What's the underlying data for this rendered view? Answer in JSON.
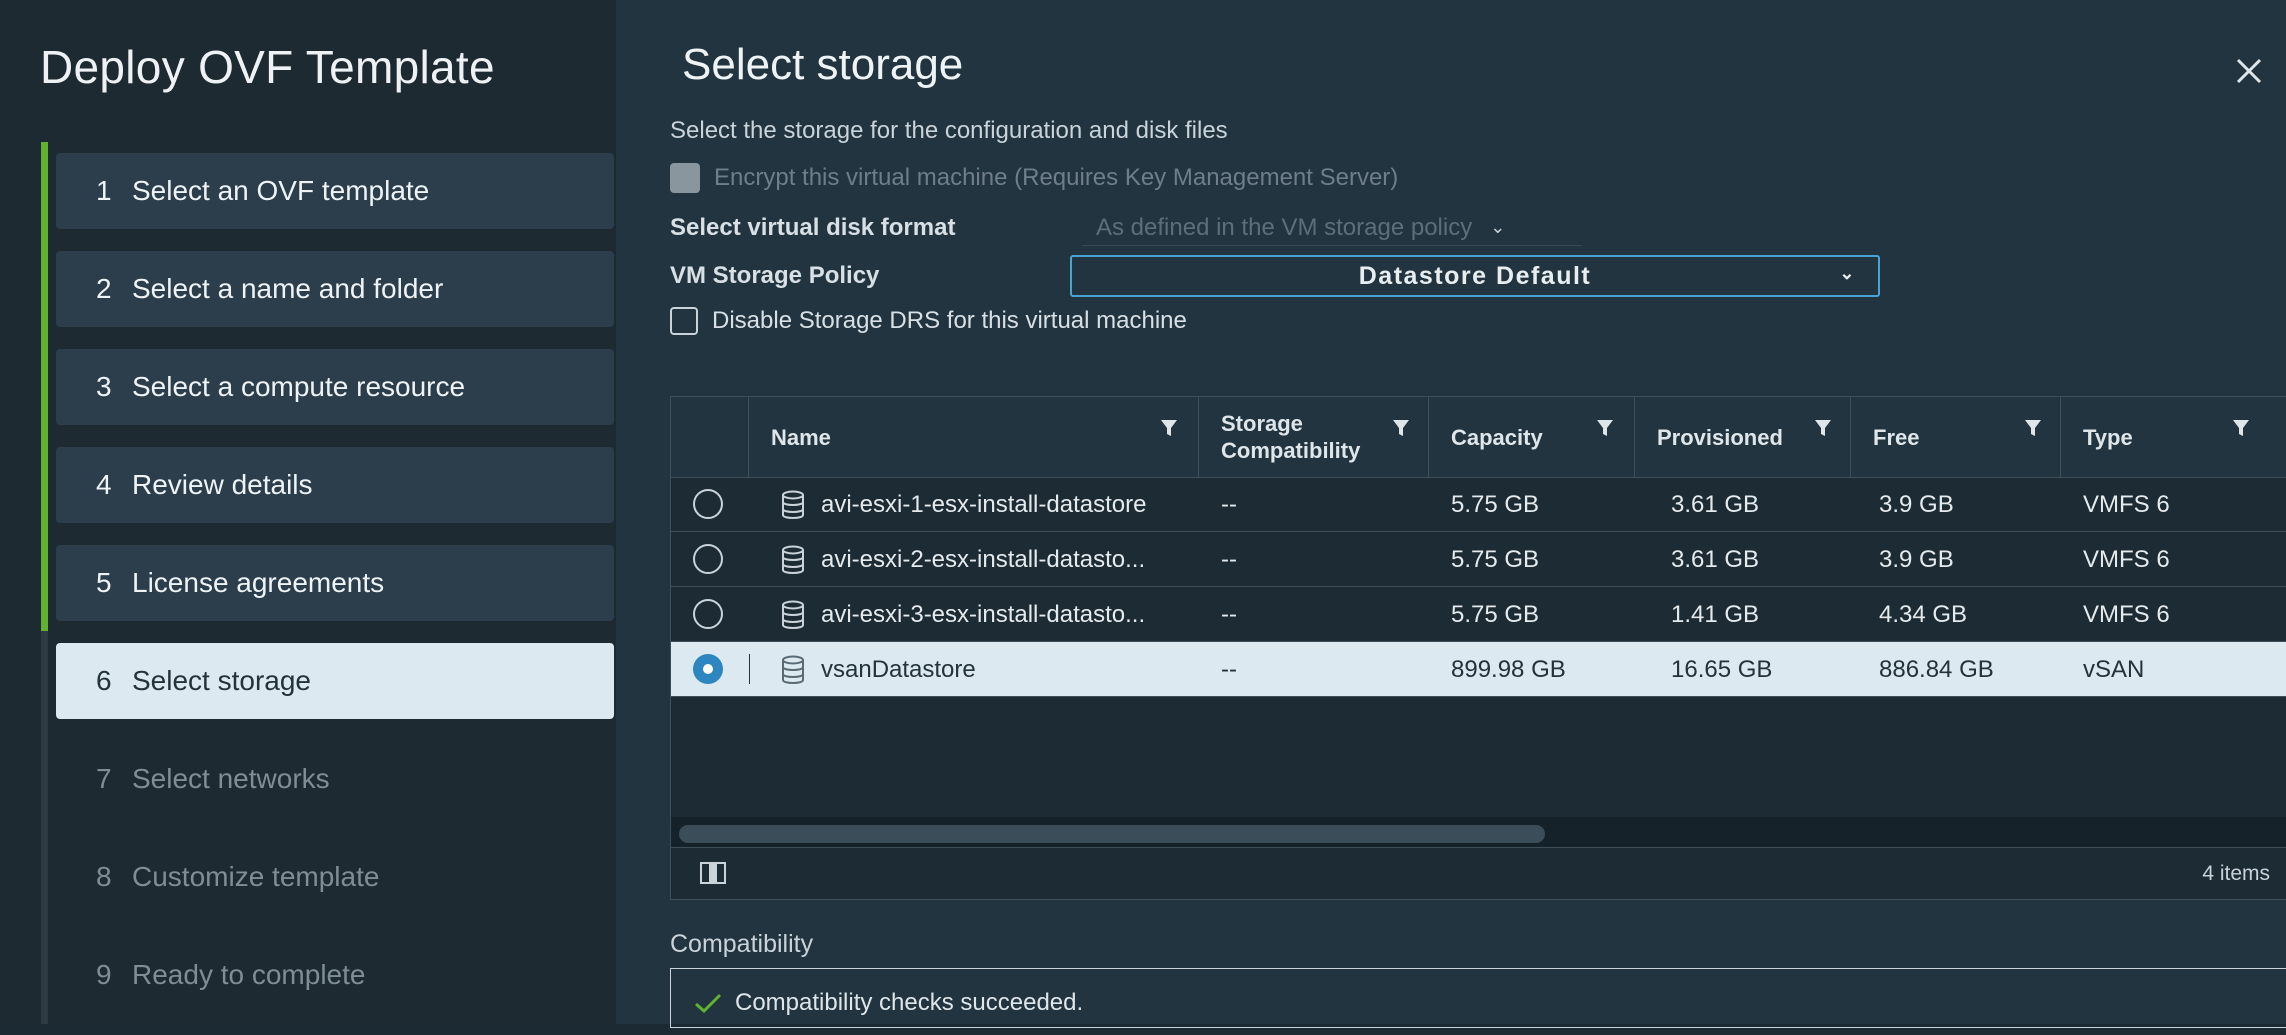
{
  "wizard": {
    "title": "Deploy OVF Template",
    "steps": [
      {
        "num": "1",
        "label": "Select an OVF template",
        "state": "done"
      },
      {
        "num": "2",
        "label": "Select a name and folder",
        "state": "done"
      },
      {
        "num": "3",
        "label": "Select a compute resource",
        "state": "done"
      },
      {
        "num": "4",
        "label": "Review details",
        "state": "done"
      },
      {
        "num": "5",
        "label": "License agreements",
        "state": "done"
      },
      {
        "num": "6",
        "label": "Select storage",
        "state": "current"
      },
      {
        "num": "7",
        "label": "Select networks",
        "state": "todo"
      },
      {
        "num": "8",
        "label": "Customize template",
        "state": "todo"
      },
      {
        "num": "9",
        "label": "Ready to complete",
        "state": "todo"
      }
    ]
  },
  "page": {
    "title": "Select storage",
    "subtitle": "Select the storage for the configuration and disk files",
    "encrypt_label": "Encrypt this virtual machine (Requires Key Management Server)",
    "disk_format_label": "Select virtual disk format",
    "disk_format_value": "As defined in the VM storage policy",
    "policy_label": "VM Storage Policy",
    "policy_value": "Datastore Default",
    "drs_label": "Disable Storage DRS for this virtual machine"
  },
  "grid": {
    "columns": [
      {
        "label": "Name"
      },
      {
        "label": "Storage\nCompatibility"
      },
      {
        "label": "Capacity"
      },
      {
        "label": "Provisioned"
      },
      {
        "label": "Free"
      },
      {
        "label": "Type"
      }
    ],
    "rows": [
      {
        "name": "avi-esxi-1-esx-install-datastore",
        "compat": "--",
        "capacity": "5.75 GB",
        "provisioned": "3.61 GB",
        "free": "3.9 GB",
        "type": "VMFS 6",
        "selected": false
      },
      {
        "name": "avi-esxi-2-esx-install-datasto...",
        "compat": "--",
        "capacity": "5.75 GB",
        "provisioned": "3.61 GB",
        "free": "3.9 GB",
        "type": "VMFS 6",
        "selected": false
      },
      {
        "name": "avi-esxi-3-esx-install-datasto...",
        "compat": "--",
        "capacity": "5.75 GB",
        "provisioned": "1.41 GB",
        "free": "4.34 GB",
        "type": "VMFS 6",
        "selected": false
      },
      {
        "name": "vsanDatastore",
        "compat": "--",
        "capacity": "899.98 GB",
        "provisioned": "16.65 GB",
        "free": "886.84 GB",
        "type": "vSAN",
        "selected": true
      }
    ],
    "items_count": "4 items"
  },
  "compatibility": {
    "label": "Compatibility",
    "message": "Compatibility checks succeeded."
  },
  "colors": {
    "accent": "#2e86c1",
    "done_rail": "#61b22e",
    "selected_row": "#dde9f0"
  }
}
